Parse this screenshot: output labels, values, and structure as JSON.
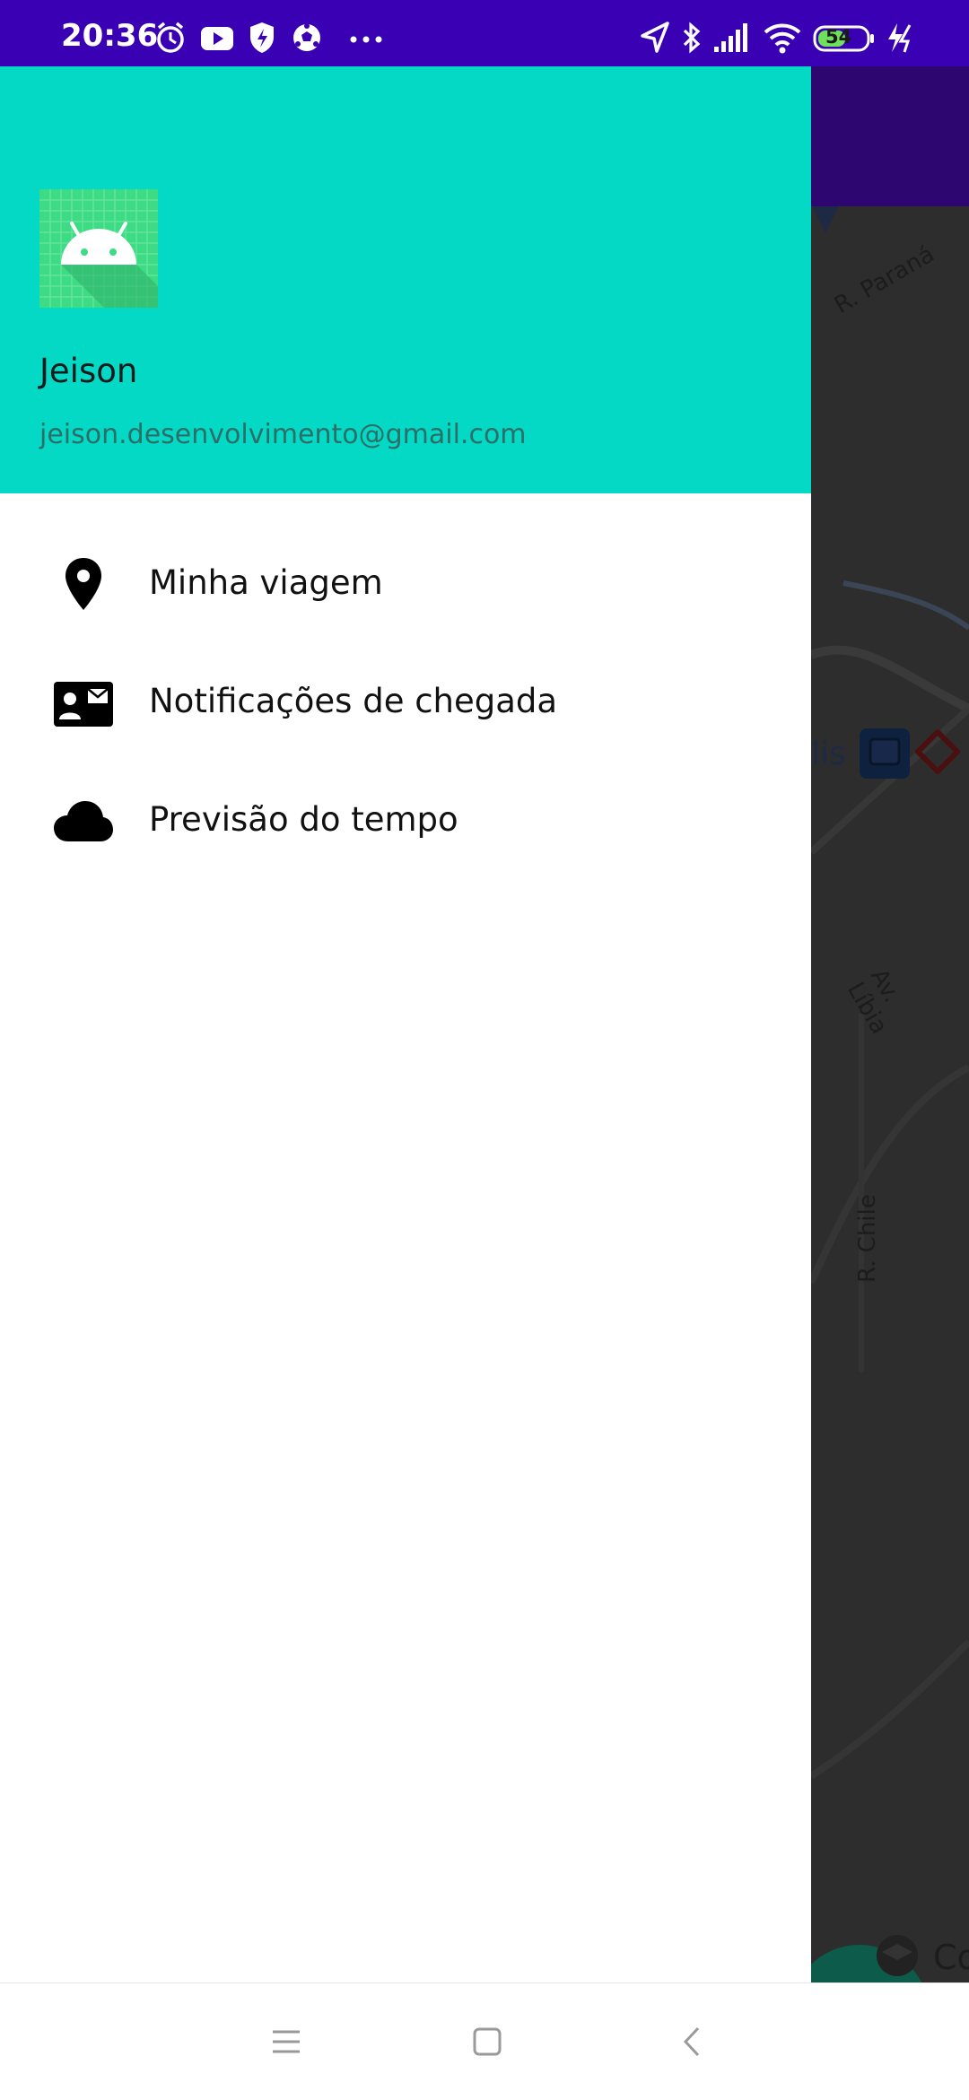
{
  "status_bar": {
    "time": "20:36",
    "battery_level": "54",
    "left_icons": [
      "alarm-icon",
      "youtube-icon",
      "shield-icon",
      "soccer-ball-icon",
      "more-dots-icon"
    ],
    "right_icons": [
      "location-arrow-icon",
      "bluetooth-icon",
      "signal-icon",
      "wifi-icon",
      "battery-icon",
      "charging-icon"
    ],
    "background_color": "#3a00b4"
  },
  "drawer": {
    "header_color": "#03d9c5",
    "user": {
      "name": "Jeison",
      "email": "jeison.desenvolvimento@gmail.com"
    },
    "menu_items": [
      {
        "label": "Minha viagem",
        "icon": "location-pin-icon"
      },
      {
        "label": "Notificações de chegada",
        "icon": "contact-mail-icon"
      },
      {
        "label": "Previsão do tempo",
        "icon": "cloud-icon"
      }
    ]
  },
  "background_map": {
    "street_labels": [
      "R. Paraná",
      "Av. Líbia",
      "R. Chile",
      "lis",
      "Co"
    ],
    "fab_icon": "plus-icon"
  },
  "nav_bar": {
    "buttons": [
      "menu-icon",
      "home-square-icon",
      "back-chevron-icon"
    ]
  }
}
